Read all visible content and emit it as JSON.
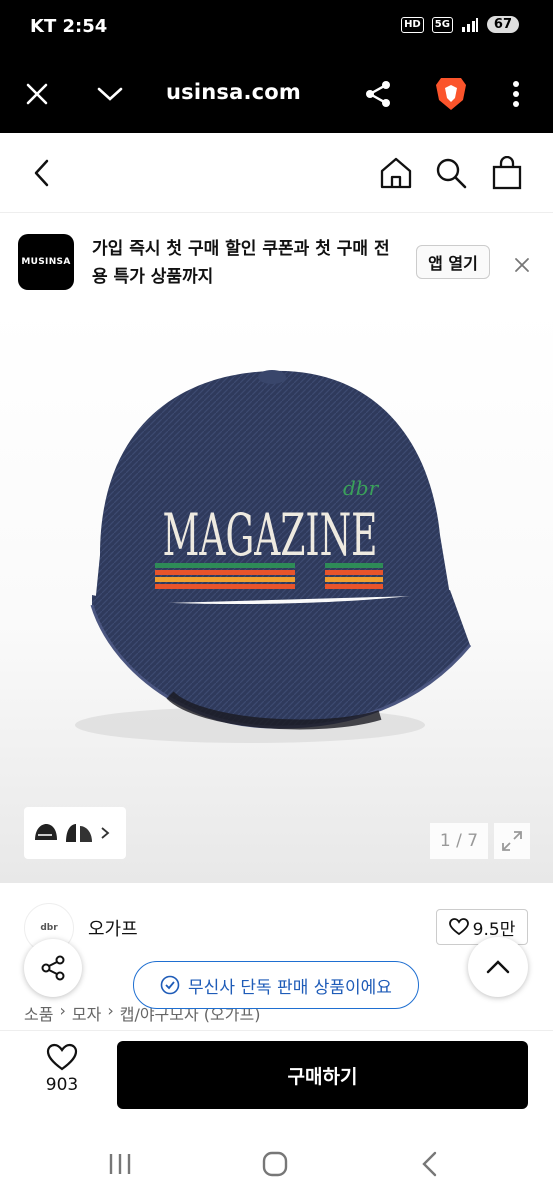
{
  "status_bar": {
    "carrier_time": "KT 2:54",
    "hd_label": "HD",
    "network_label": "5G",
    "battery": "67"
  },
  "browser": {
    "url": "usinsa.com",
    "icons": [
      "close-icon",
      "chevron-down-icon",
      "share-icon",
      "brave-lion-icon",
      "more-vert-icon"
    ]
  },
  "header": {
    "icons": [
      "back-icon",
      "home-icon",
      "search-icon",
      "cart-icon"
    ]
  },
  "banner": {
    "logo_text": "MUSINSA",
    "text": "가입 즉시 첫 구매 할인 쿠폰과 첫 구매 전용 특가 상품까지",
    "open_label": "앱 열기"
  },
  "gallery": {
    "cap_text": "MAGAZINE",
    "cap_script": "dbr",
    "counter": "1 / 7",
    "thumbnail_count": 2
  },
  "product": {
    "brand_logo_text": "dbr",
    "brand_name": "오가프",
    "like_count": "9.5만",
    "breadcrumb": [
      "소품",
      "모자",
      "캡/야구모자 (오가프)"
    ],
    "exclusive_notice": "무신사 단독 판매 상품이에요"
  },
  "buy_bar": {
    "wish_count": "903",
    "buy_label": "구매하기"
  },
  "colors": {
    "accent_blue": "#1f5cb8",
    "brave_orange": "#fb542b",
    "denim": "#2f3a5c"
  }
}
